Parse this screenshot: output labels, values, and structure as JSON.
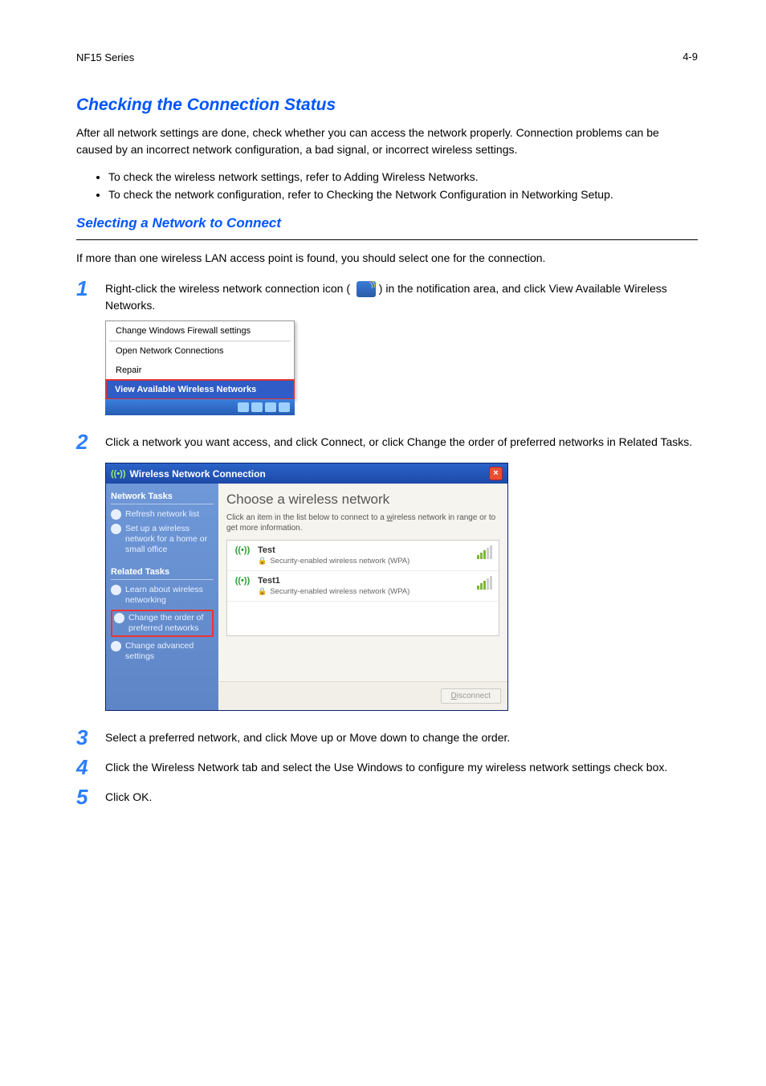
{
  "header": {
    "title": "NF15 Series",
    "page": "4-9"
  },
  "sec1": {
    "title": "Checking the Connection Status",
    "para": "After all network settings are done, check whether you can access the network properly. Connection problems can be caused by an incorrect network configuration, a bad signal, or incorrect wireless settings.",
    "bullets": [
      "To check the wireless network settings, refer to Adding Wireless Networks.",
      "To check the network configuration, refer to Checking the Network Configuration in Networking Setup."
    ]
  },
  "sec2": {
    "title": "Selecting a Network to Connect",
    "intro": "If more than one wireless LAN access point is found, you should select one for the connection.",
    "steps": [
      {
        "num": "1",
        "text_a": "Right-click the wireless network connection icon (",
        "text_b": ") in the notification area, and click View Available Wireless Networks."
      },
      {
        "num": "2",
        "text": "Click a network you want access, and click Connect, or click Change the order of preferred networks in Related Tasks."
      },
      {
        "num": "3",
        "text": "Select a preferred network, and click Move up or Move down to change the order."
      },
      {
        "num": "4",
        "text": "Click the Wireless Network tab and select the Use Windows to configure my wireless network settings check box."
      },
      {
        "num": "5",
        "text": "Click OK."
      }
    ]
  },
  "menu_shot": {
    "items": [
      "Change Windows Firewall settings",
      "Open Network Connections",
      "Repair"
    ],
    "highlight": "View Available Wireless Networks"
  },
  "wifi_shot": {
    "title": "Wireless Network Connection",
    "main_title": "Choose a wireless network",
    "subtitle_a": "Click an item in the list below to connect to a ",
    "subtitle_u": "w",
    "subtitle_b": "ireless network in range or to get more information.",
    "sidebar": {
      "head1": "Network Tasks",
      "link1": "Refresh network list",
      "link2": "Set up a wireless network for a home or small office",
      "head2": "Related Tasks",
      "link3": "Learn about wireless networking",
      "link4": "Change the order of preferred networks",
      "link5": "Change advanced settings"
    },
    "networks": [
      {
        "name": "Test",
        "sec": "Security-enabled wireless network (WPA)"
      },
      {
        "name": "Test1",
        "sec": "Security-enabled wireless network (WPA)"
      }
    ],
    "disconnect_u": "D",
    "disconnect_rest": "isconnect"
  }
}
